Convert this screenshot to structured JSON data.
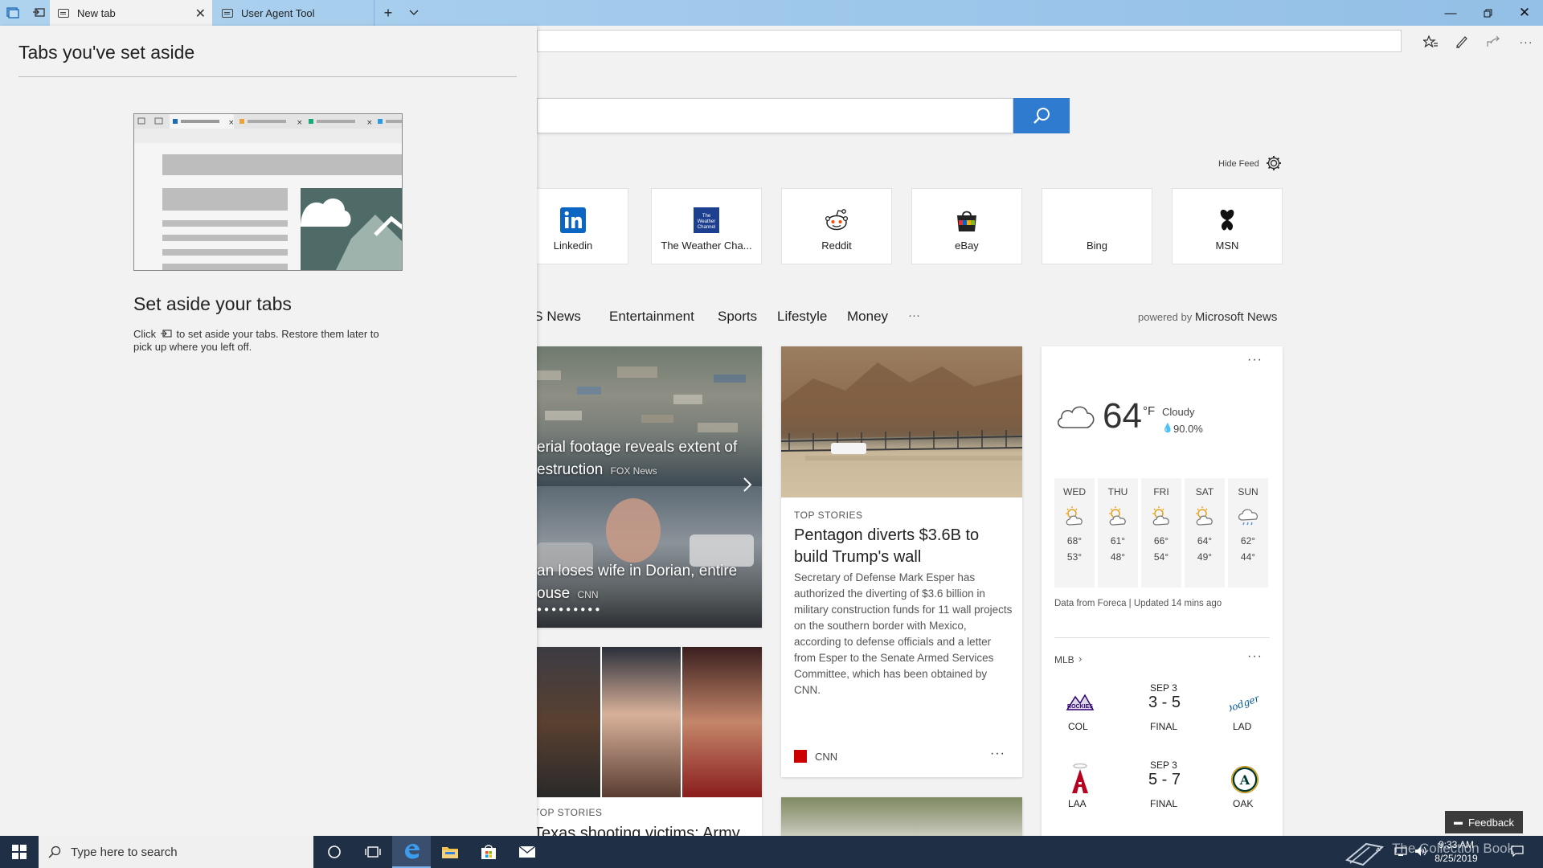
{
  "tabs": [
    {
      "label": "New tab"
    },
    {
      "label": "User Agent Tool"
    }
  ],
  "set_aside": {
    "heading": "Tabs you've set aside",
    "title": "Set aside your tabs",
    "hint_before": "Click",
    "hint_after": "to set aside your tabs. Restore them later to pick up where you left off."
  },
  "feed": {
    "hide_label": "Hide Feed",
    "top_sites": [
      "Linkedin",
      "The Weather Cha...",
      "Reddit",
      "eBay",
      "Bing",
      "MSN"
    ],
    "categories": [
      "US News",
      "Entertainment",
      "Sports",
      "Lifestyle",
      "Money",
      "···"
    ],
    "powered_prefix": "powered by",
    "powered_brand": "Microsoft News"
  },
  "slideshow": {
    "slide1_title": "erial footage reveals extent of estruction",
    "slide1_source": "FOX News",
    "slide2_title": "an loses wife in Dorian, entire ouse",
    "slide2_source": "CNN"
  },
  "story": {
    "label": "TOP STORIES",
    "headline": "Pentagon diverts $3.6B to build Trump's wall",
    "body": "Secretary of Defense Mark Esper has authorized the diverting of $3.6 billion in military construction funds for 11 wall projects on the southern border with Mexico, according to defense officials and a letter from Esper to the Senate Armed Services Committee, which has been obtained by CNN.",
    "source": "CNN",
    "more": "···"
  },
  "story2": {
    "label": "TOP STORIES",
    "headline": "Texas shooting victims: Army"
  },
  "weather": {
    "temp": "64",
    "unit": "°F",
    "condition": "Cloudy",
    "precip": "90.0%",
    "more": "···",
    "days": [
      {
        "name": "WED",
        "high": "68°",
        "low": "53°"
      },
      {
        "name": "THU",
        "high": "61°",
        "low": "48°"
      },
      {
        "name": "FRI",
        "high": "66°",
        "low": "54°"
      },
      {
        "name": "SAT",
        "high": "64°",
        "low": "49°"
      },
      {
        "name": "SUN",
        "high": "62°",
        "low": "44°"
      }
    ],
    "credit": "Data from Foreca | Updated 14 mins ago"
  },
  "mlb": {
    "label": "MLB",
    "more": "···",
    "games": [
      {
        "home": "COL",
        "away": "LAD",
        "date": "SEP 3",
        "score": "3 - 5",
        "status": "FINAL"
      },
      {
        "home": "LAA",
        "away": "OAK",
        "date": "SEP 3",
        "score": "5 - 7",
        "status": "FINAL"
      }
    ]
  },
  "feedback_label": "Feedback",
  "taskbar": {
    "search_placeholder": "Type here to search",
    "time": "9:33 AM",
    "date": "8/25/2019",
    "watermark": "The Collection Book"
  },
  "colors": {
    "accent": "#2e7bcf",
    "titlebar": "#9cc6ea",
    "taskbar": "#1f2f45"
  }
}
